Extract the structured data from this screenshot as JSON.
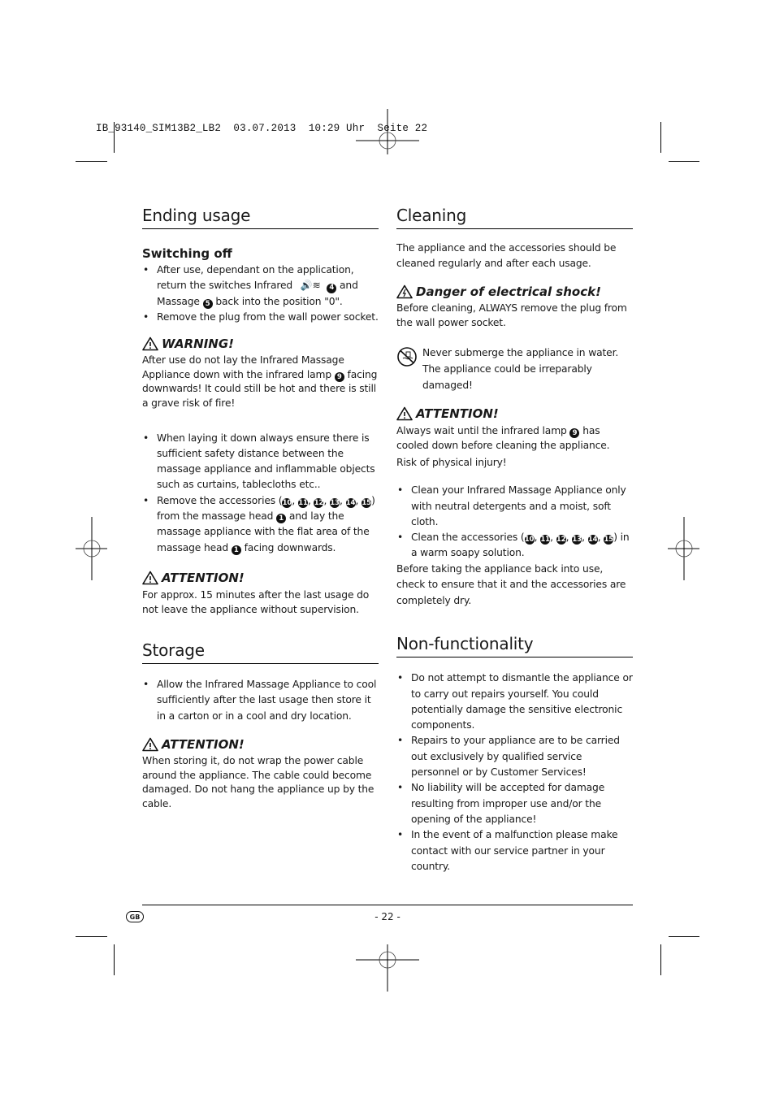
{
  "slug": "IB_93140_SIM13B2_LB2  03.07.2013  10:29 Uhr  Seite 22",
  "left": {
    "ending_usage": {
      "title": "Ending usage",
      "switching_off": {
        "title": "Switching off",
        "item1_a": "After use, dependant on the application, return the switches Infrared",
        "item1_icon": "infrared-symbol",
        "item1_num4": "4",
        "item1_b": "and",
        "item1_c": "Massage",
        "item1_num5": "5",
        "item1_d": "back into the position \"0\".",
        "item2": "Remove the plug from the wall power socket."
      },
      "warning": {
        "label": "WARNING!",
        "text_a": "After use do not lay the Infrared Massage Appliance down with the infrared lamp",
        "num": "9",
        "text_b": "facing downwards! It could still be hot and there is still a grave risk of fire!"
      },
      "bullets": {
        "item1": "When laying it down always ensure there is sufficient safety distance between the massage appliance and inflammable objects such as curtains, tablecloths etc..",
        "item2_a": "Remove the accessories (",
        "acc": [
          "10",
          "11",
          "12",
          "13",
          "14",
          "15"
        ],
        "item2_b": ") from the massage head",
        "num1": "1",
        "item2_c": "and lay the massage appliance with the flat area of the massage head",
        "item2_d": "facing downwards."
      },
      "attention": {
        "label": "ATTENTION!",
        "text": "For approx. 15 minutes after the last usage do not leave the appliance without supervision."
      }
    },
    "storage": {
      "title": "Storage",
      "item1": "Allow the Infrared Massage Appliance to cool sufficiently after the last usage then store it in a carton or in a cool and dry location.",
      "attention": {
        "label": "ATTENTION!",
        "text": "When storing it, do not wrap the power cable around the appliance. The cable could become damaged. Do not hang the appliance up by the cable."
      }
    }
  },
  "right": {
    "cleaning": {
      "title": "Cleaning",
      "intro": "The appliance and the accessories should be cleaned regularly and after each usage.",
      "danger": {
        "label": "Danger of electrical shock!",
        "text": "Before cleaning, ALWAYS remove the plug from the wall power socket."
      },
      "nosubmerge": {
        "line1": "Never submerge the appliance in water.",
        "line2": "The appliance could be irreparably damaged!"
      },
      "attention": {
        "label": "ATTENTION!",
        "text_a": "Always wait until the infrared lamp",
        "num": "9",
        "text_b": "has cooled down before cleaning the appliance.",
        "risk": "Risk of physical injury!"
      },
      "bullets": {
        "item1": "Clean your Infrared Massage Appliance only with neutral detergents and a moist, soft cloth.",
        "item2_a": "Clean the accessories (",
        "acc": [
          "10",
          "11",
          "12",
          "13",
          "14",
          "15"
        ],
        "item2_b": ") in a warm soapy solution."
      },
      "outro": "Before taking the appliance back into use, check to ensure that it and the accessories are completely dry."
    },
    "nonfunc": {
      "title": "Non-functionality",
      "items": [
        "Do not attempt to dismantle the appliance or to carry out repairs yourself. You could potentially damage the sensitive electronic components.",
        "Repairs to your appliance are to be carried out exclusively by qualified service personnel or by Customer Services!",
        "No liability will be accepted for damage resulting from improper use and/or the opening of the appliance!",
        "In the event of a malfunction please make contact with our service partner in your country."
      ]
    }
  },
  "footer": {
    "country": "GB",
    "page": "- 22 -"
  }
}
